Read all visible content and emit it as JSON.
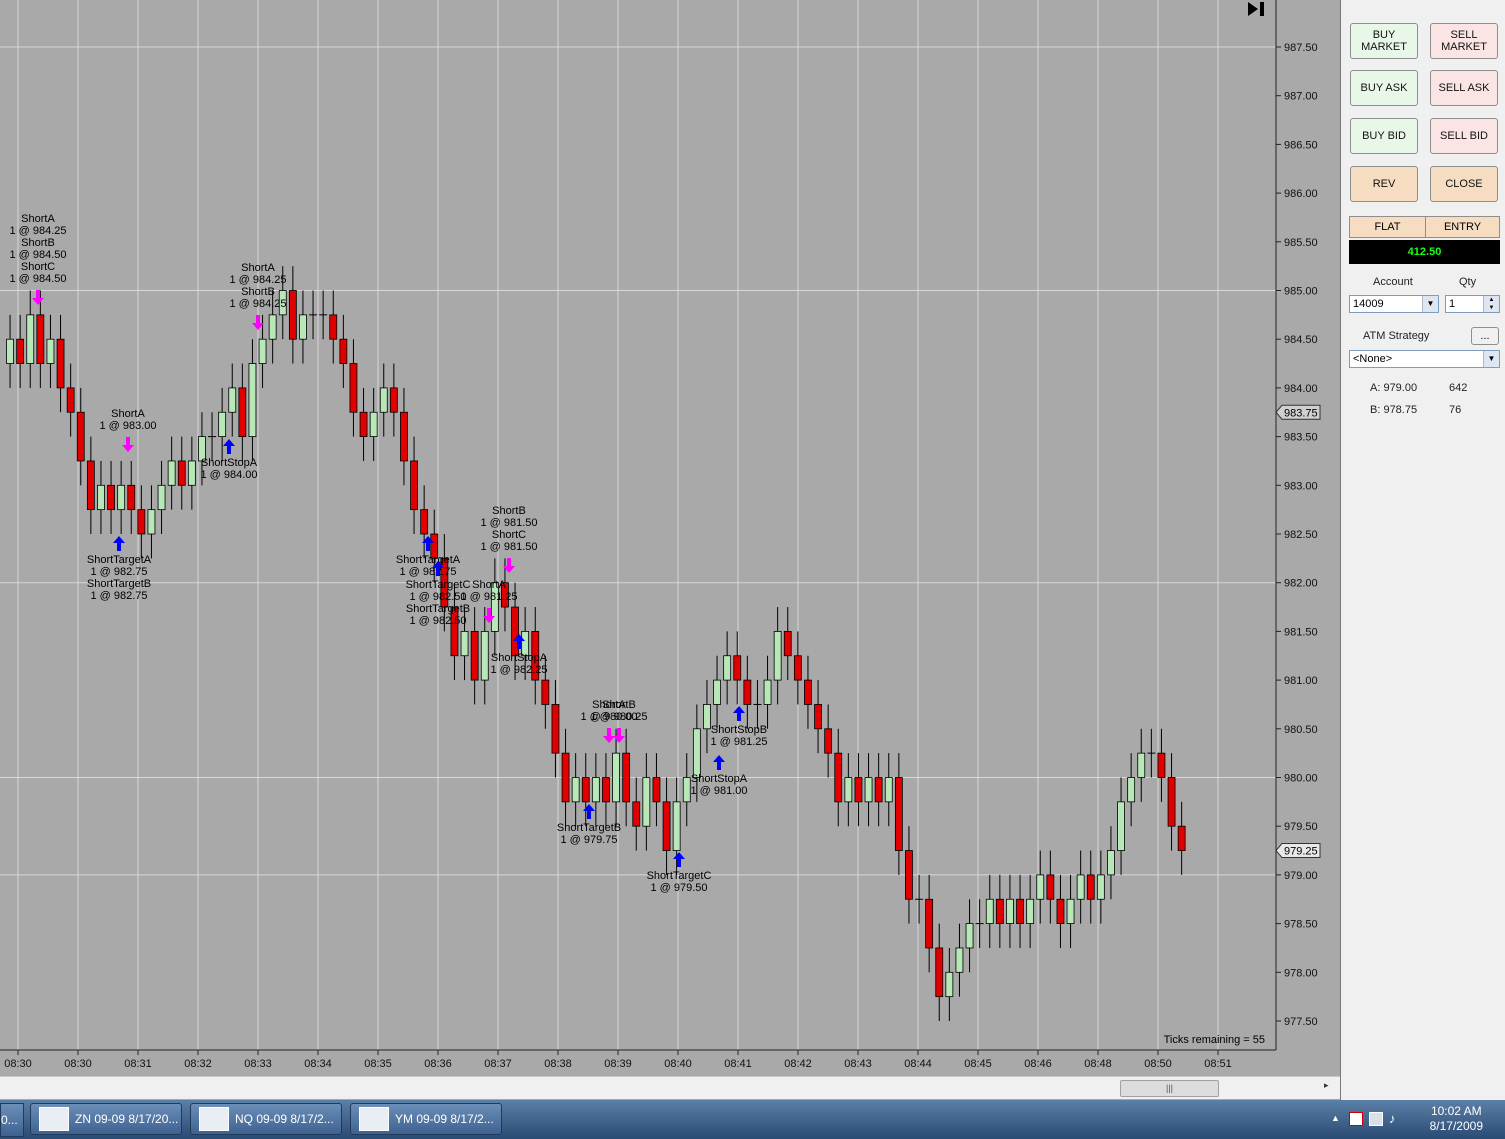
{
  "chart": {
    "ticks_remaining": "Ticks remaining = 55",
    "price_labels": [
      "987.50",
      "987.00",
      "986.50",
      "986.00",
      "985.50",
      "985.00",
      "984.50",
      "984.00",
      "983.50",
      "983.00",
      "982.50",
      "982.00",
      "981.50",
      "981.00",
      "980.50",
      "980.00",
      "979.50",
      "979.00",
      "978.50",
      "978.00",
      "977.50"
    ],
    "time_labels": [
      "08:30",
      "08:30",
      "08:31",
      "08:32",
      "08:33",
      "08:34",
      "08:35",
      "08:36",
      "08:37",
      "08:38",
      "08:39",
      "08:40",
      "08:41",
      "08:42",
      "08:43",
      "08:44",
      "08:45",
      "08:46",
      "08:48",
      "08:50",
      "08:51"
    ],
    "ask_marker": "983.75",
    "last_marker": "979.25",
    "colors": {
      "background": "#a9a9a9",
      "up": "#b8e8b8",
      "down": "#e00000",
      "entry_arrow": "#ff00ff",
      "exit_arrow": "#0000ff"
    },
    "annotations": [
      {
        "lines": [
          "ShortA",
          "1 @ 984.25",
          "ShortB",
          "1 @ 984.50",
          "ShortC",
          "1 @ 984.50"
        ],
        "arrow": "down"
      },
      {
        "lines": [
          "ShortA",
          "1 @ 984.25",
          "ShortB",
          "1 @ 984.25"
        ],
        "arrow": "down"
      },
      {
        "lines": [
          "ShortA",
          "1 @ 983.00"
        ],
        "arrow": "down"
      },
      {
        "lines": [
          "ShortStopA",
          "1 @ 984.00"
        ],
        "arrow": "up"
      },
      {
        "lines": [
          "ShortTargetA",
          "1 @ 982.75",
          "ShortTargetB",
          "1 @ 982.75"
        ],
        "arrow": "up"
      },
      {
        "lines": [
          "ShortTargetA",
          "1 @ 982.75"
        ],
        "arrow": "up"
      },
      {
        "lines": [
          "ShortTargetC",
          "1 @ 982.50",
          "ShortTargetB",
          "1 @ 982.50"
        ],
        "arrow": "up"
      },
      {
        "lines": [
          "ShortA",
          "1 @ 981.25"
        ],
        "arrow": "down"
      },
      {
        "lines": [
          "ShortB",
          "1 @ 981.50",
          "ShortC",
          "1 @ 981.50"
        ],
        "arrow": "down"
      },
      {
        "lines": [
          "ShortStopA",
          "1 @ 982.25"
        ],
        "arrow": "up"
      },
      {
        "lines": [
          "ShortA",
          "1 @ 980.00"
        ],
        "arrow": "down"
      },
      {
        "lines": [
          "ShortB",
          "1 @ 980.25"
        ],
        "arrow": "down"
      },
      {
        "lines": [
          "ShortTargetB",
          "1 @ 979.75"
        ],
        "arrow": "up"
      },
      {
        "lines": [
          "ShortTargetC",
          "1 @ 979.50"
        ],
        "arrow": "up"
      },
      {
        "lines": [
          "ShortStopA",
          "1 @ 981.00"
        ],
        "arrow": "up"
      },
      {
        "lines": [
          "ShortStopB",
          "1 @ 981.25"
        ],
        "arrow": "up"
      }
    ]
  },
  "chart_data": {
    "type": "candlestick",
    "ylim": [
      977.25,
      988.0
    ],
    "x": [
      "08:30",
      "08:30",
      "08:31",
      "08:32",
      "08:33",
      "08:34",
      "08:35",
      "08:36",
      "08:37",
      "08:38",
      "08:39",
      "08:40",
      "08:41",
      "08:42",
      "08:43",
      "08:44",
      "08:45",
      "08:46",
      "08:48",
      "08:50",
      "08:51"
    ],
    "close_series": [
      984.5,
      984.25,
      984.75,
      984.25,
      984.5,
      984.0,
      983.75,
      983.25,
      982.75,
      983.0,
      982.75,
      983.0,
      982.75,
      982.5,
      982.75,
      983.0,
      983.25,
      983.0,
      983.25,
      983.5,
      983.5,
      983.75,
      984.0,
      983.5,
      984.25,
      984.5,
      984.75,
      985.0,
      984.5,
      984.75,
      984.75,
      984.75,
      984.5,
      984.25,
      983.75,
      983.5,
      983.75,
      984.0,
      983.75,
      983.25,
      982.75,
      982.5,
      982.25,
      981.75,
      981.25,
      981.5,
      981.0,
      981.5,
      982.0,
      981.75,
      981.25,
      981.5,
      981.0,
      980.75,
      980.25,
      979.75,
      980.0,
      979.75,
      980.0,
      979.75,
      980.25,
      979.75,
      979.5,
      980.0,
      979.75,
      979.25,
      979.75,
      980.0,
      980.5,
      980.75,
      981.0,
      981.25,
      981.0,
      980.75,
      980.75,
      981.0,
      981.5,
      981.25,
      981.0,
      980.75,
      980.5,
      980.25,
      979.75,
      980.0,
      979.75,
      980.0,
      979.75,
      980.0,
      979.25,
      978.75,
      978.75,
      978.25,
      977.75,
      978.0,
      978.25,
      978.5,
      978.5,
      978.75,
      978.5,
      978.75,
      978.5,
      978.75,
      979.0,
      978.75,
      978.5,
      978.75,
      979.0,
      978.75,
      979.0,
      979.25,
      979.75,
      980.0,
      980.25,
      980.25,
      980.0,
      979.5,
      979.25
    ]
  },
  "panel": {
    "buy_market": "BUY MARKET",
    "sell_market": "SELL MARKET",
    "buy_ask": "BUY ASK",
    "sell_ask": "SELL ASK",
    "buy_bid": "BUY BID",
    "sell_bid": "SELL BID",
    "rev": "REV",
    "close": "CLOSE",
    "flat": "FLAT",
    "entry": "ENTRY",
    "pnl": "412.50",
    "account_label": "Account",
    "qty_label": "Qty",
    "account_value": "14009",
    "qty_value": "1",
    "atm_label": "ATM Strategy",
    "atm_button": "...",
    "atm_value": "<None>",
    "ask_label": "A: 979.00",
    "ask_size": "642",
    "bid_label": "B: 978.75",
    "bid_size": "76"
  },
  "taskbar": {
    "items": [
      "ZN 09-09  8/17/20...",
      "NQ 09-09  8/17/2...",
      "YM 09-09  8/17/2..."
    ],
    "time": "10:02 AM",
    "date": "8/17/2009"
  }
}
